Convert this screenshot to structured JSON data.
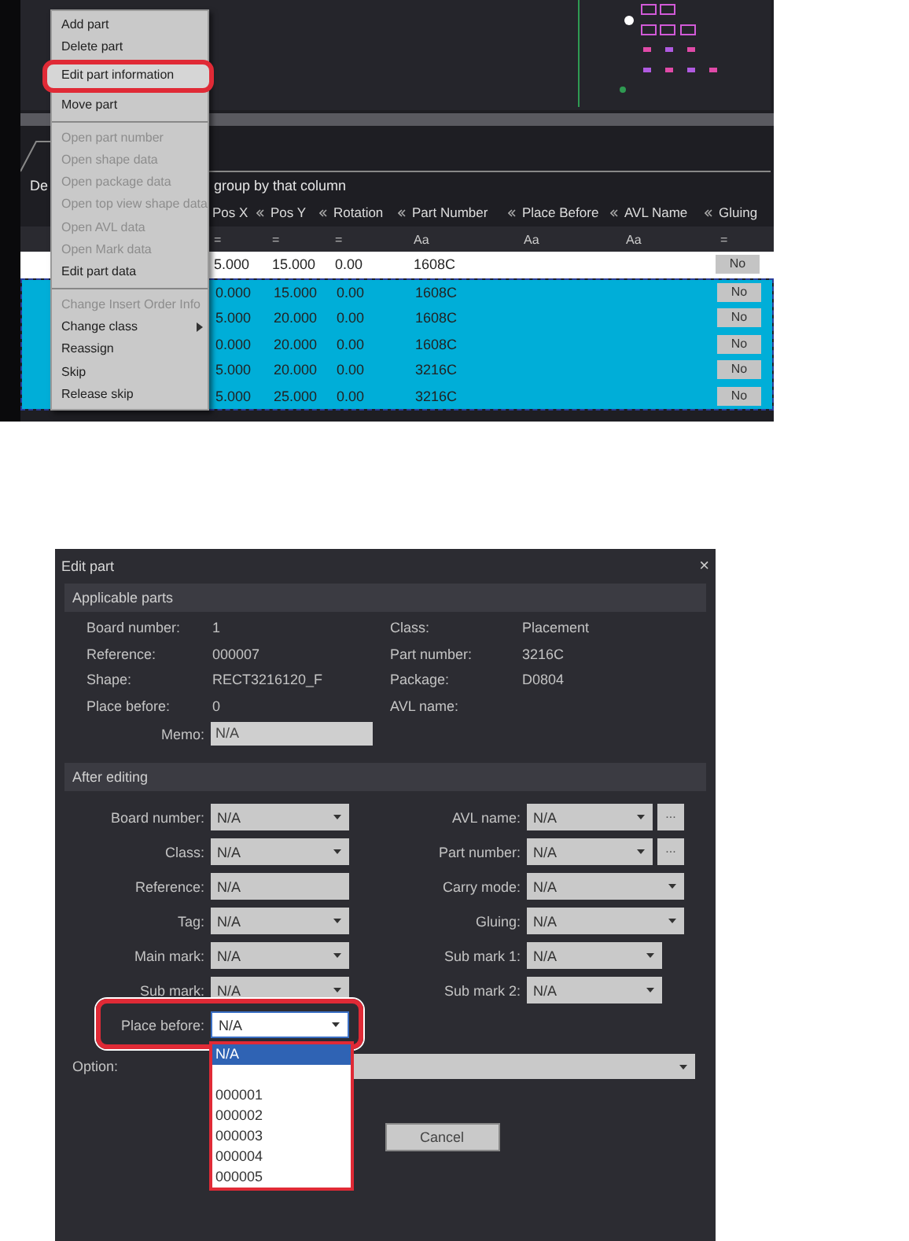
{
  "context_menu": {
    "items": [
      {
        "kind": "item",
        "label": "Add part",
        "disabled": false,
        "selected": false,
        "submenu": false
      },
      {
        "kind": "item",
        "label": "Delete part",
        "disabled": false,
        "selected": false,
        "submenu": false
      },
      {
        "kind": "item",
        "label": "Edit part information",
        "disabled": false,
        "selected": true,
        "submenu": false
      },
      {
        "kind": "item",
        "label": "Move part",
        "disabled": false,
        "selected": false,
        "submenu": false
      },
      {
        "kind": "separator"
      },
      {
        "kind": "item",
        "label": "Open part number",
        "disabled": true,
        "selected": false,
        "submenu": false
      },
      {
        "kind": "item",
        "label": "Open shape data",
        "disabled": true,
        "selected": false,
        "submenu": false
      },
      {
        "kind": "item",
        "label": "Open package data",
        "disabled": true,
        "selected": false,
        "submenu": false
      },
      {
        "kind": "item",
        "label": "Open top view shape data",
        "disabled": true,
        "selected": false,
        "submenu": false
      },
      {
        "kind": "item",
        "label": "Open AVL data",
        "disabled": true,
        "selected": false,
        "submenu": false
      },
      {
        "kind": "item",
        "label": "Open Mark data",
        "disabled": true,
        "selected": false,
        "submenu": false
      },
      {
        "kind": "item",
        "label": "Edit part data",
        "disabled": false,
        "selected": false,
        "submenu": false
      },
      {
        "kind": "separator"
      },
      {
        "kind": "item",
        "label": "Change Insert Order Info",
        "disabled": true,
        "selected": false,
        "submenu": false
      },
      {
        "kind": "item",
        "label": "Change class",
        "disabled": false,
        "selected": false,
        "submenu": true
      },
      {
        "kind": "item",
        "label": "Reassign",
        "disabled": false,
        "selected": false,
        "submenu": false
      },
      {
        "kind": "item",
        "label": "Skip",
        "disabled": false,
        "selected": false,
        "submenu": false
      },
      {
        "kind": "item",
        "label": "Release skip",
        "disabled": false,
        "selected": false,
        "submenu": false
      }
    ]
  },
  "group_panel": {
    "text_start": "De",
    "text_end": "group by that column"
  },
  "table": {
    "columns": [
      {
        "label": "Pos X",
        "filter": "="
      },
      {
        "label": "Pos Y",
        "filter": "="
      },
      {
        "label": "Rotation",
        "filter": "="
      },
      {
        "label": "Part Number",
        "filter": "Aa"
      },
      {
        "label": "Place Before",
        "filter": "Aa"
      },
      {
        "label": "AVL Name",
        "filter": "Aa"
      },
      {
        "label": "Gluing",
        "filter": "="
      }
    ],
    "rows": [
      {
        "selected": false,
        "cells": [
          "5.000",
          "15.000",
          "0.00",
          "1608C"
        ],
        "gluing": "No"
      },
      {
        "selected": true,
        "cells": [
          "0.000",
          "15.000",
          "0.00",
          "1608C"
        ],
        "gluing": "No"
      },
      {
        "selected": true,
        "cells": [
          "5.000",
          "20.000",
          "0.00",
          "1608C"
        ],
        "gluing": "No"
      },
      {
        "selected": true,
        "cells": [
          "0.000",
          "20.000",
          "0.00",
          "1608C"
        ],
        "gluing": "No"
      },
      {
        "selected": true,
        "cells": [
          "5.000",
          "20.000",
          "0.00",
          "3216C"
        ],
        "gluing": "No"
      },
      {
        "selected": true,
        "cells": [
          "5.000",
          "25.000",
          "0.00",
          "3216C"
        ],
        "gluing": "No"
      }
    ]
  },
  "dialog": {
    "title": "Edit part",
    "close": "×",
    "applicable": {
      "header": "Applicable parts",
      "info": [
        {
          "label": "Board number:",
          "value": "1"
        },
        {
          "label": "Class:",
          "value": "Placement"
        },
        {
          "label": "Reference:",
          "value": "000007"
        },
        {
          "label": "Part number:",
          "value": "3216C"
        },
        {
          "label": "Shape:",
          "value": "RECT3216120_F"
        },
        {
          "label": "Package:",
          "value": "D0804"
        },
        {
          "label": "Place before:",
          "value": "0"
        },
        {
          "label": "AVL name:"
        }
      ],
      "memo": {
        "label": "Memo:",
        "value": "N/A"
      }
    },
    "after": {
      "header": "After editing",
      "left": [
        {
          "kind": "combo",
          "label": "Board number:",
          "value": "N/A",
          "highlighted": false,
          "expanded": false
        },
        {
          "kind": "combo",
          "label": "Class:",
          "value": "N/A",
          "highlighted": false,
          "expanded": false
        },
        {
          "kind": "text",
          "label": "Reference:",
          "value": "N/A",
          "highlighted": false,
          "expanded": false
        },
        {
          "kind": "combo",
          "label": "Tag:",
          "value": "N/A",
          "highlighted": false,
          "expanded": false
        },
        {
          "kind": "combo",
          "label": "Main mark:",
          "value": "N/A",
          "highlighted": false,
          "expanded": false
        },
        {
          "kind": "combo",
          "label": "Sub mark:",
          "value": "N/A",
          "highlighted": false,
          "expanded": false
        },
        {
          "kind": "combo",
          "label": "Place before:",
          "value": "N/A",
          "highlighted": true,
          "expanded": true
        }
      ],
      "right": [
        {
          "kind": "combo_more",
          "label": "AVL name:",
          "value": "N/A",
          "more": "..."
        },
        {
          "kind": "combo_more",
          "label": "Part number:",
          "value": "N/A",
          "more": "..."
        },
        {
          "kind": "combo_wide",
          "label": "Carry mode:",
          "value": "N/A"
        },
        {
          "kind": "combo_wide",
          "label": "Gluing:",
          "value": "N/A"
        },
        {
          "kind": "combo",
          "label": "Sub mark 1:",
          "value": "N/A"
        },
        {
          "kind": "combo",
          "label": "Sub mark 2:",
          "value": "N/A"
        }
      ]
    },
    "dropdown": [
      {
        "kind": "value",
        "label": "N/A",
        "selected": true
      },
      {
        "kind": "blank"
      },
      {
        "kind": "value",
        "label": "000001",
        "selected": false
      },
      {
        "kind": "value",
        "label": "000002",
        "selected": false
      },
      {
        "kind": "value",
        "label": "000003",
        "selected": false
      },
      {
        "kind": "value",
        "label": "000004",
        "selected": false
      },
      {
        "kind": "value",
        "label": "000005",
        "selected": false
      }
    ],
    "option": {
      "label": "Option:"
    },
    "cancel": "Cancel"
  }
}
